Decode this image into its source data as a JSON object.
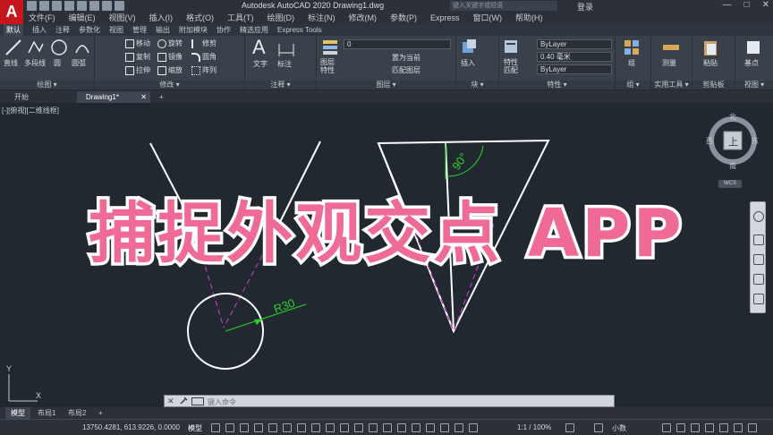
{
  "titlebar": {
    "logo": "A",
    "title": "Autodesk AutoCAD 2020    Drawing1.dwg",
    "search_placeholder": "键入关键字或短语",
    "login": "登录",
    "min": "—",
    "max": "□",
    "close": "✕"
  },
  "menubar": {
    "items": [
      "文件(F)",
      "编辑(E)",
      "视图(V)",
      "插入(I)",
      "格式(O)",
      "工具(T)",
      "绘图(D)",
      "标注(N)",
      "修改(M)",
      "参数(P)",
      "Express",
      "窗口(W)",
      "帮助(H)"
    ]
  },
  "ribbon_tabs": [
    "默认",
    "插入",
    "注释",
    "参数化",
    "视图",
    "管理",
    "输出",
    "附加模块",
    "协作",
    "精选应用",
    "Express Tools"
  ],
  "ribbon": {
    "draw": {
      "label": "绘图 ▾",
      "line": "直线",
      "polyline": "多段线",
      "circle": "圆",
      "arc": "圆弧"
    },
    "modify": {
      "label": "修改 ▾",
      "move": "移动",
      "rotate": "旋转",
      "trim": "修剪",
      "copy": "复制",
      "mirror": "镜像",
      "fillet": "圆角",
      "stretch": "拉伸",
      "scale": "缩放",
      "array": "阵列"
    },
    "annotation": {
      "label": "注释 ▾",
      "text": "文字",
      "dimension": "标注"
    },
    "layers": {
      "label": "图层 ▾",
      "props": "图层\n特性",
      "layer_value": "0",
      "set_current": "置为当前",
      "match": "匹配图层"
    },
    "block": {
      "label": "块 ▾",
      "insert": "插入"
    },
    "properties": {
      "label": "特性 ▾",
      "match": "特性\n匹配",
      "bylayer1": "ByLayer",
      "lineweight": "0.40 毫米",
      "bylayer2": "ByLayer"
    },
    "groups": {
      "label": "组 ▾",
      "group": "组"
    },
    "utilities": {
      "label": "实用工具 ▾",
      "measure": "测量"
    },
    "clipboard": {
      "label": "剪贴板",
      "paste": "粘贴"
    },
    "view": {
      "label": "视图 ▾",
      "base": "基点"
    }
  },
  "doc_tabs": {
    "start": "开始",
    "drawing": "Drawing1*",
    "close": "✕",
    "add": "+"
  },
  "viewport_label": "[-][俯视][二维线框]",
  "canvas": {
    "radius_label": "R30",
    "angle_label": "90°",
    "ucs_y": "Y",
    "ucs_x": "X"
  },
  "overlay_title": "捕捉外观交点 APP",
  "viewcube": {
    "north": "北",
    "south": "南",
    "east": "东",
    "west": "西",
    "top": "上",
    "wcs": "WCS"
  },
  "command": {
    "close": "✕",
    "wrench": "🔧",
    "placeholder": "键入命令"
  },
  "layout_tabs": [
    "模型",
    "布局1",
    "布局2",
    "+"
  ],
  "statusbar": {
    "coords": "13750.4281, 613.9226, 0.0000",
    "model": "模型",
    "scale": "1:1 / 100%",
    "units": "小数"
  },
  "colors": {
    "canvas_bg": "#212830",
    "overlay_fill": "#ef6b96",
    "dim_green": "#2bd12b",
    "magenta_dash": "#b53fb8"
  }
}
